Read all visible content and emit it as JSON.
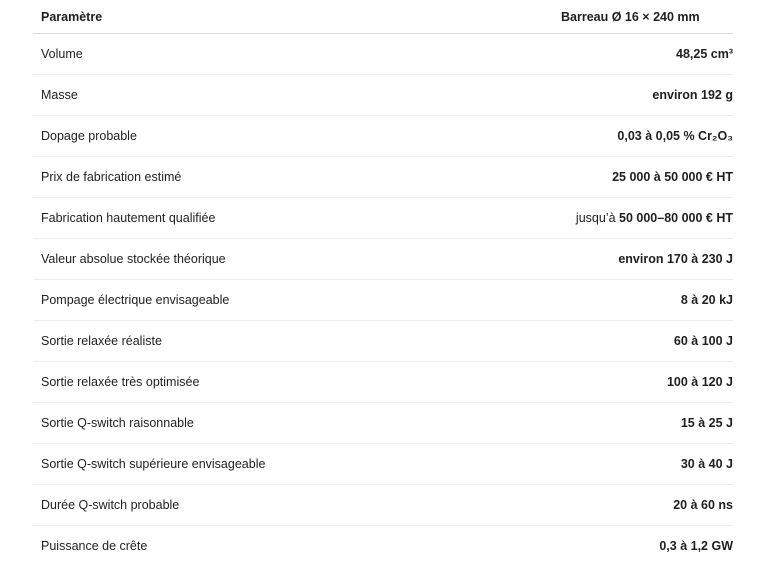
{
  "table": {
    "headers": {
      "param": "Paramètre",
      "value": "Barreau Ø 16 × 240 mm"
    },
    "rows": [
      {
        "label": "Volume",
        "value": "48,25 cm³"
      },
      {
        "label": "Masse",
        "value": "environ 192 g"
      },
      {
        "label": "Dopage probable",
        "value": "0,03 à 0,05 % Cr₂O₃"
      },
      {
        "label": "Prix de fabrication estimé",
        "value": "25 000 à 50 000 € HT"
      },
      {
        "label": "Fabrication hautement qualifiée",
        "value_prefix": "jusqu’à ",
        "value": "50 000–80 000 € HT"
      },
      {
        "label": "Valeur absolue stockée théorique",
        "value": "environ 170 à 230 J"
      },
      {
        "label": "Pompage électrique envisageable",
        "value": "8 à 20 kJ"
      },
      {
        "label": "Sortie relaxée réaliste",
        "value": "60 à 100 J"
      },
      {
        "label": "Sortie relaxée très optimisée",
        "value": "100 à 120 J"
      },
      {
        "label": "Sortie Q-switch raisonnable",
        "value": "15 à 25 J"
      },
      {
        "label": "Sortie Q-switch supérieure envisageable",
        "value": "30 à 40 J"
      },
      {
        "label": "Durée Q-switch probable",
        "value": "20 à 60 ns"
      },
      {
        "label": "Puissance de crête",
        "value": "0,3 à 1,2 GW"
      }
    ]
  }
}
